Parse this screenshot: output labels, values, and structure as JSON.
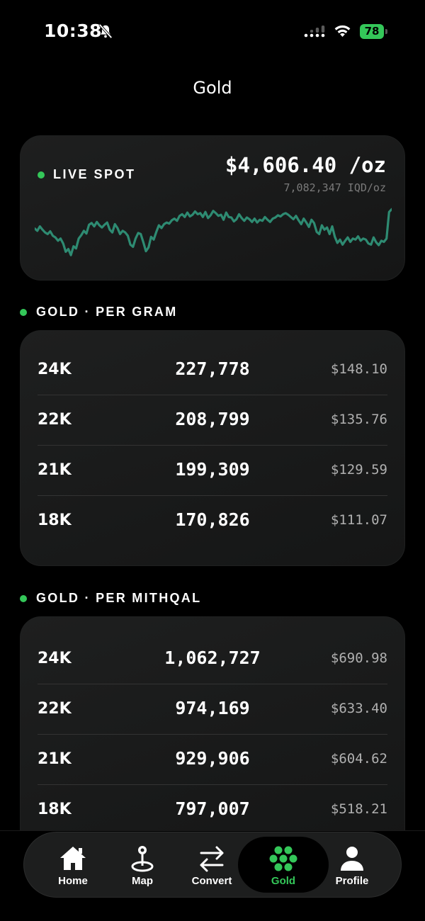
{
  "status": {
    "time": "10:38",
    "battery": "78"
  },
  "title": "Gold",
  "spot": {
    "label": "LIVE SPOT",
    "price": "$4,606.40 /oz",
    "sub": "7,082,347 IQD/oz",
    "line_color": "#2e8b72",
    "series": [
      0.62,
      0.58,
      0.66,
      0.6,
      0.55,
      0.52,
      0.57,
      0.49,
      0.46,
      0.4,
      0.44,
      0.35,
      0.2,
      0.25,
      0.14,
      0.3,
      0.26,
      0.44,
      0.5,
      0.58,
      0.53,
      0.69,
      0.72,
      0.66,
      0.74,
      0.68,
      0.64,
      0.69,
      0.73,
      0.6,
      0.55,
      0.7,
      0.63,
      0.52,
      0.58,
      0.55,
      0.49,
      0.33,
      0.29,
      0.44,
      0.54,
      0.52,
      0.37,
      0.21,
      0.28,
      0.47,
      0.42,
      0.56,
      0.68,
      0.63,
      0.7,
      0.73,
      0.71,
      0.77,
      0.8,
      0.76,
      0.85,
      0.88,
      0.83,
      0.91,
      0.84,
      0.87,
      0.93,
      0.88,
      0.9,
      0.83,
      0.92,
      0.81,
      0.86,
      0.94,
      0.9,
      0.85,
      0.87,
      0.78,
      0.91,
      0.83,
      0.82,
      0.75,
      0.79,
      0.88,
      0.81,
      0.76,
      0.82,
      0.79,
      0.74,
      0.8,
      0.73,
      0.78,
      0.76,
      0.83,
      0.78,
      0.74,
      0.8,
      0.82,
      0.86,
      0.84,
      0.88,
      0.9,
      0.87,
      0.83,
      0.79,
      0.85,
      0.77,
      0.7,
      0.8,
      0.73,
      0.65,
      0.78,
      0.72,
      0.56,
      0.52,
      0.68,
      0.6,
      0.64,
      0.52,
      0.66,
      0.47,
      0.36,
      0.42,
      0.33,
      0.4,
      0.46,
      0.38,
      0.44,
      0.42,
      0.48,
      0.4,
      0.44,
      0.42,
      0.35,
      0.33,
      0.46,
      0.37,
      0.32,
      0.4,
      0.38,
      0.44,
      0.92,
      0.97
    ]
  },
  "gram": {
    "header": "GOLD · PER GRAM",
    "rows": [
      {
        "karat": "24K",
        "iqd": "227,778",
        "usd": "$148.10"
      },
      {
        "karat": "22K",
        "iqd": "208,799",
        "usd": "$135.76"
      },
      {
        "karat": "21K",
        "iqd": "199,309",
        "usd": "$129.59"
      },
      {
        "karat": "18K",
        "iqd": "170,826",
        "usd": "$111.07"
      }
    ]
  },
  "mithqal": {
    "header": "GOLD · PER MITHQAL",
    "rows": [
      {
        "karat": "24K",
        "iqd": "1,062,727",
        "usd": "$690.98"
      },
      {
        "karat": "22K",
        "iqd": "974,169",
        "usd": "$633.40"
      },
      {
        "karat": "21K",
        "iqd": "929,906",
        "usd": "$604.62"
      },
      {
        "karat": "18K",
        "iqd": "797,007",
        "usd": "$518.21"
      }
    ]
  },
  "tabs": [
    {
      "label": "Home",
      "icon": "home-icon"
    },
    {
      "label": "Map",
      "icon": "map-pin-icon"
    },
    {
      "label": "Convert",
      "icon": "convert-arrows-icon"
    },
    {
      "label": "Gold",
      "icon": "gold-coins-icon",
      "active": true
    },
    {
      "label": "Profile",
      "icon": "profile-icon"
    }
  ],
  "accent": "#34c759"
}
